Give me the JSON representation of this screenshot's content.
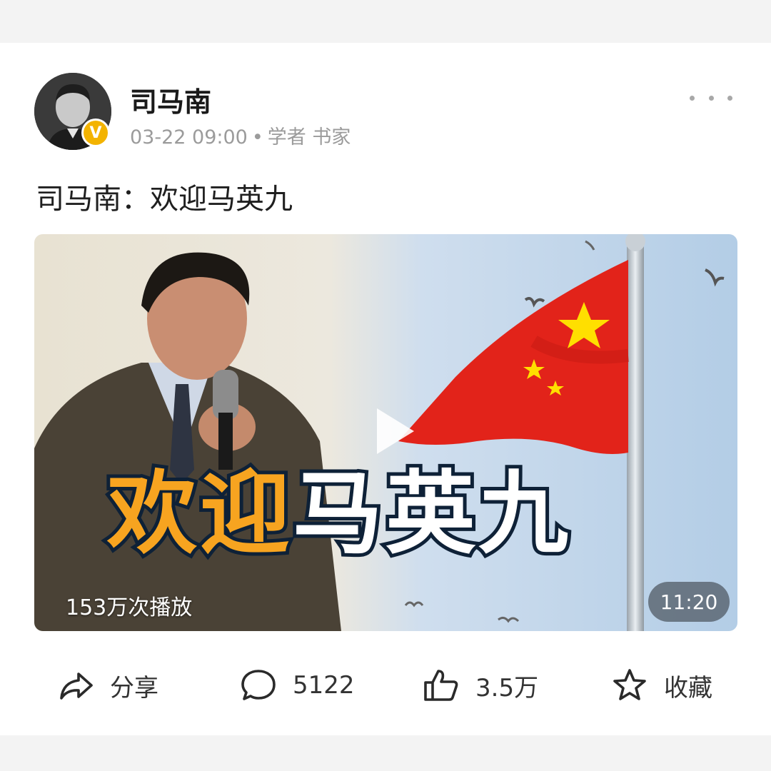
{
  "post": {
    "author": "司马南",
    "verified_badge": "V",
    "time": "03-22 09:00",
    "separator": "•",
    "tags": "学者 书家",
    "title": "司马南：欢迎马英九"
  },
  "video": {
    "overlay_title_part1": "欢迎",
    "overlay_title_part2": "马英九",
    "play_count": "153万次播放",
    "duration": "11:20"
  },
  "actions": {
    "share_label": "分享",
    "comment_count": "5122",
    "like_count": "3.5万",
    "favorite_label": "收藏"
  },
  "icons": {
    "more": "more-dots-icon",
    "share": "share-icon",
    "comment": "comment-icon",
    "like": "thumbs-up-icon",
    "favorite": "star-icon",
    "play": "play-icon"
  },
  "colors": {
    "badge": "#f3b300",
    "overlay_accent": "#f7a420",
    "overlay_outline": "#0e2137",
    "flag_red": "#e2231a"
  }
}
